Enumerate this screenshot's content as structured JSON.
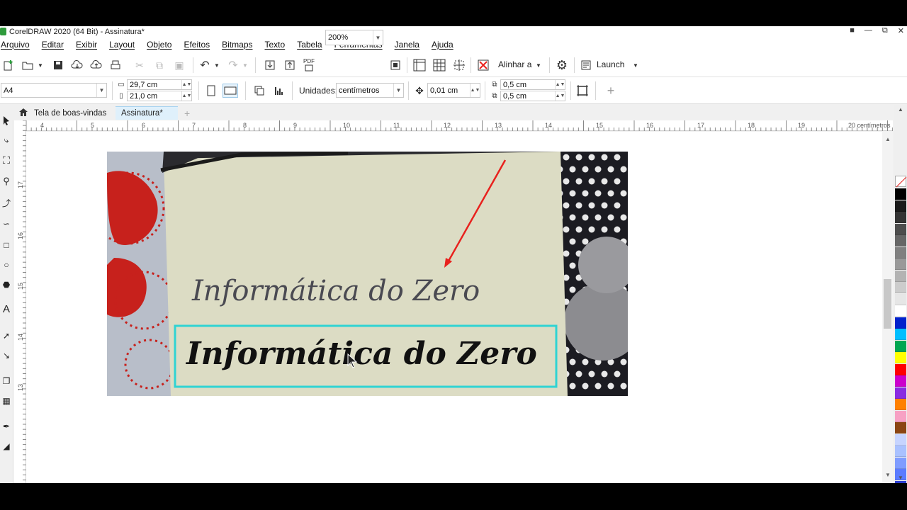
{
  "window": {
    "title": "CorelDRAW 2020 (64 Bit) - Assinatura*"
  },
  "menu": [
    "Arquivo",
    "Editar",
    "Exibir",
    "Layout",
    "Objeto",
    "Efeitos",
    "Bitmaps",
    "Texto",
    "Tabela",
    "Ferramentas",
    "Janela",
    "Ajuda"
  ],
  "toolbar": {
    "pdf_label": "PDF",
    "zoom_value": "200%",
    "align_label": "Alinhar a",
    "launch_label": "Launch"
  },
  "property_bar": {
    "page_size": "A4",
    "width": "29,7 cm",
    "height": "21,0 cm",
    "units_label": "Unidades:",
    "units_value": "centímetros",
    "nudge": "0,01 cm",
    "dup_x": "0,5 cm",
    "dup_y": "0,5 cm"
  },
  "tabs": [
    {
      "label": "Tela de boas-vindas",
      "icon": "home-icon"
    },
    {
      "label": "Assinatura*",
      "active": true
    }
  ],
  "ruler": {
    "top_numbers": [
      "4",
      "5",
      "6",
      "7",
      "8",
      "9",
      "10",
      "11",
      "12",
      "13",
      "14",
      "15",
      "16",
      "17",
      "18",
      "19"
    ],
    "top_end_label": "20 centímetros",
    "left_numbers": [
      "17",
      "16",
      "15",
      "14",
      "13"
    ]
  },
  "canvas": {
    "handwritten_text_1": "Informática do Zero",
    "handwritten_text_2": "Informática do Zero"
  },
  "colors": {
    "accent_selection": "#2fd3d3",
    "arrow": "#e8211d",
    "paper": "#dcdcc4",
    "tab_active": "#dff0fb"
  },
  "palette": [
    "#ffffff",
    "#000000",
    "#1a1a1a",
    "#333333",
    "#4d4d4d",
    "#666666",
    "#808080",
    "#999999",
    "#b3b3b3",
    "#cccccc",
    "#e6e6e6",
    "#ffffff",
    "#0022cc",
    "#00bfff",
    "#00a651",
    "#ffff00",
    "#ff0000",
    "#cc00cc",
    "#8a2be2",
    "#ff8000",
    "#f7a1c4",
    "#8b4513",
    "#c6d4ff",
    "#a9c1ff",
    "#7f9cff",
    "#5b7bff",
    "#2d3fd0"
  ]
}
